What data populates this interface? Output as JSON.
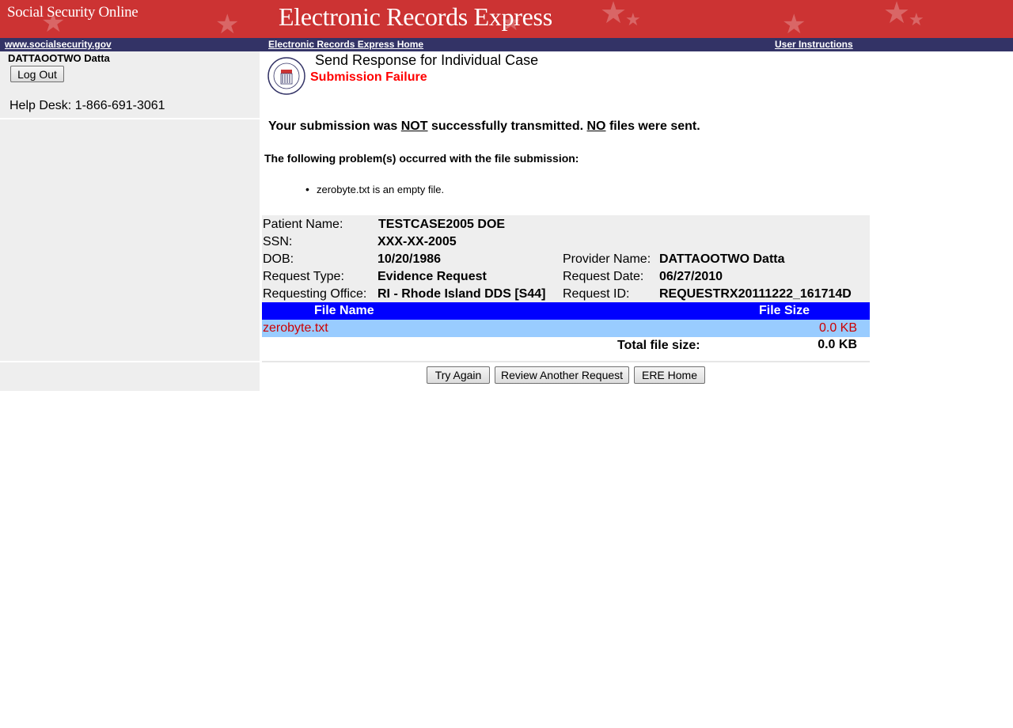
{
  "header": {
    "site_name": "Social Security Online",
    "app_title": "Electronic Records Express",
    "background_color": "#cc3333"
  },
  "nav": {
    "link_site": "www.socialsecurity.gov",
    "link_home": "Electronic Records Express Home",
    "link_instructions": "User Instructions",
    "background_color": "#333366"
  },
  "sidebar": {
    "username": "DATTAOOTWO  Datta",
    "logout_label": "Log Out",
    "helpdesk": "Help Desk: 1-866-691-3061"
  },
  "page": {
    "title": "Send Response for Individual Case",
    "subtitle": "Submission Failure",
    "message_part1": "Your submission was ",
    "message_not": "NOT",
    "message_part2": " successfully transmitted. ",
    "message_no": "NO",
    "message_part3": " files were sent.",
    "problems_heading": "The following problem(s) occurred with the file submission:",
    "problems": [
      "zerobyte.txt is an empty file."
    ]
  },
  "case": {
    "patient_name_label": "Patient Name:",
    "patient_name": "TESTCASE2005 DOE",
    "ssn_label": "SSN:",
    "ssn": "XXX-XX-2005",
    "dob_label": "DOB:",
    "dob": "10/20/1986",
    "request_type_label": "Request Type:",
    "request_type": "Evidence Request",
    "requesting_office_label": "Requesting Office:",
    "requesting_office": "RI - Rhode Island DDS [S44]",
    "provider_name_label": "Provider Name:",
    "provider_name": "DATTAOOTWO Datta",
    "request_date_label": "Request Date:",
    "request_date": "06/27/2010",
    "request_id_label": "Request ID:",
    "request_id": "REQUESTRX20111222_161714D"
  },
  "files": {
    "col_name": "File Name",
    "col_size": "File Size",
    "rows": [
      {
        "name": "zerobyte.txt",
        "size": "0.0 KB"
      }
    ],
    "total_label": "Total file size:",
    "total_value": "0.0 KB"
  },
  "actions": {
    "try_again": "Try Again",
    "review_another": "Review Another Request",
    "ere_home": "ERE Home"
  }
}
